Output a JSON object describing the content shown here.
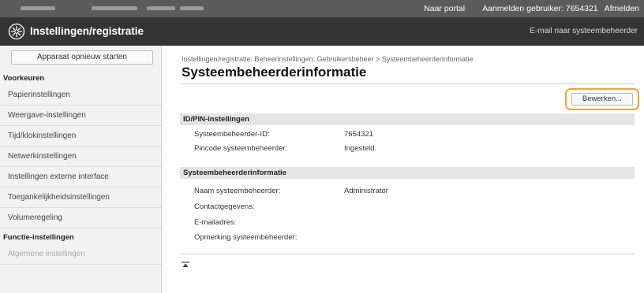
{
  "topbar": {
    "portal_link": "Naar portal",
    "user_label": "Aanmelden gebruiker:  7654321",
    "logout_link": "Afmelden"
  },
  "header": {
    "title": "Instellingen/registratie",
    "mail_link": "E-mail naar systeembeheerder"
  },
  "sidebar": {
    "restart_button": "Apparaat opnieuw starten",
    "section1": "Voorkeuren",
    "items": [
      {
        "label": "Papierinstellingen"
      },
      {
        "label": "Weergave-instellingen"
      },
      {
        "label": "Tijd/klokinstellingen"
      },
      {
        "label": "Netwerkinstellingen"
      },
      {
        "label": "Instellingen externe interface"
      },
      {
        "label": "Toegankelijkheidsinstellingen"
      },
      {
        "label": "Volumeregeling"
      }
    ],
    "section2": "Functie-instellingen",
    "items2": [
      {
        "label": "Algemene instellingen"
      }
    ]
  },
  "main": {
    "breadcrumb": "Instellingen/registratie: Beheerinstellingen: Gebruikersbeheer > Systeembeheerderinformatie",
    "title": "Systeembeheerderinformatie",
    "edit_button": "Bewerken...",
    "section_id": {
      "heading": "ID/PIN-instellingen",
      "rows": [
        {
          "label": "Systeembeheerder-ID:",
          "value": "7654321"
        },
        {
          "label": "Pincode systeembeheerder:",
          "value": "Ingesteld."
        }
      ]
    },
    "section_info": {
      "heading": "Systeembeheerderinformatie",
      "rows": [
        {
          "label": "Naam systeembeheerder:",
          "value": "Administrator"
        },
        {
          "label": "Contactgegevens:",
          "value": ""
        },
        {
          "label": "E-mailadres:",
          "value": ""
        },
        {
          "label": "Opmerking systeembeheerder:",
          "value": ""
        }
      ]
    }
  },
  "colors": {
    "highlight": "#f0a33a",
    "header_bg": "#343434",
    "topbar_bg": "#5b5b5b"
  },
  "icons": {
    "logo": "gear-settings-icon",
    "page_top": "scroll-to-top-icon"
  }
}
